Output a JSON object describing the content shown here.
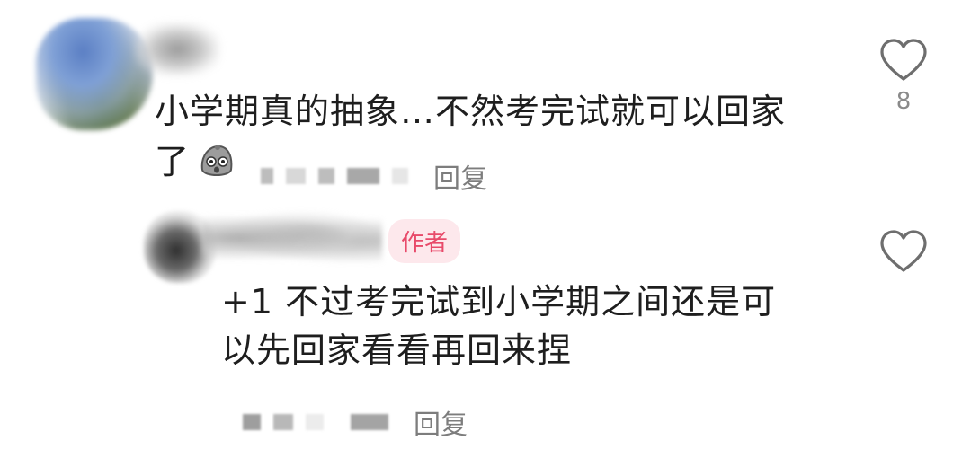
{
  "comments": [
    {
      "text_line1": "小学期真的抽象…不然考完试就可以回家",
      "text_line2": "了",
      "emoji": "shocked-face-emoji",
      "reply_label": "回复",
      "like_count": "8"
    },
    {
      "badge": "作者",
      "text_line1": "+1 不过考完试到小学期之间还是可",
      "text_line2": "以先回家看看再回来捏",
      "reply_label": "回复",
      "like_count": ""
    }
  ],
  "colors": {
    "text": "#1e1e1e",
    "meta": "#7d7d7d",
    "badge_bg": "#fde8ec",
    "badge_text": "#e84a6a",
    "icon": "#6e6e6e"
  },
  "icons": [
    "heart-outline-icon"
  ]
}
